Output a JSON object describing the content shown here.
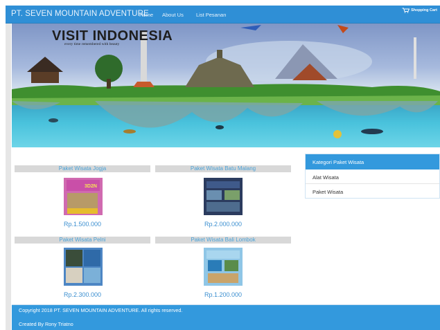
{
  "navbar": {
    "brand": "PT. SEVEN MOUNTAIN ADVENTURE",
    "links": [
      "Home",
      "About Us",
      "List Pesanan"
    ],
    "cart_label": "Shopping Cart",
    "cart_icon": "cart-icon"
  },
  "hero": {
    "title": "VISIT INDONESIA",
    "subtitle": "every time remembered with beauty"
  },
  "products": [
    {
      "title": "Paket Wisata Jogja",
      "price": "Rp.1.500.000",
      "poster_text": "3D2N"
    },
    {
      "title": "Paket Wisata Batu Malang",
      "price": "Rp.2.000.000"
    },
    {
      "title": "Paket Wisata Pelni",
      "price": "Rp.2.300.000"
    },
    {
      "title": "Paket Wisata Bali Lombok",
      "price": "Rp.1.200.000"
    }
  ],
  "sidebar": {
    "heading": "Kategori Paket Wisata",
    "items": [
      "Alat Wisata",
      "Paket Wisata"
    ]
  },
  "footer": {
    "copyright": "Copyright 2018 PT. SEVEN MOUNTAIN ADVENTURE. All rights reserved.",
    "credit": "Created By Rony Triatno"
  },
  "colors": {
    "nav": "#2f8fd6",
    "accent": "#3399dd",
    "price": "#3b8fd0",
    "title_bg": "#d8d8d8"
  }
}
